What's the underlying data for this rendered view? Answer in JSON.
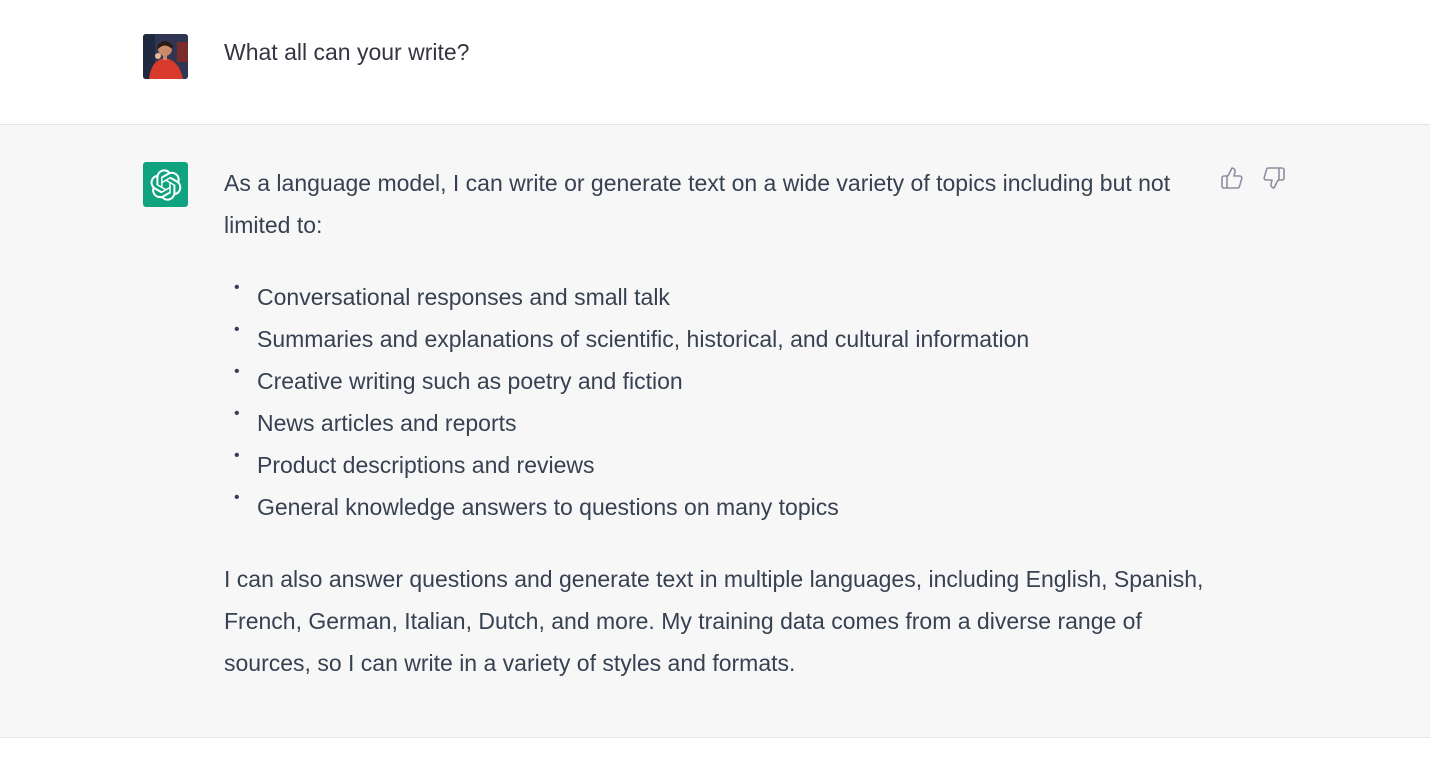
{
  "conversation": {
    "user_message": {
      "text": "What all can your write?",
      "avatar_icon": "user-photo-avatar"
    },
    "assistant_message": {
      "avatar_icon": "openai-logo-icon",
      "avatar_color": "#10a37f",
      "intro": "As a language model, I can write or generate text on a wide variety of topics including but not limited to:",
      "items": [
        "Conversational responses and small talk",
        "Summaries and explanations of scientific, historical, and cultural information",
        "Creative writing such as poetry and fiction",
        "News articles and reports",
        "Product descriptions and reviews",
        "General knowledge answers to questions on many topics"
      ],
      "closing": "I can also answer questions and generate text in multiple languages, including English, Spanish, French, German, Italian, Dutch, and more. My training data comes from a diverse range of sources, so I can write in a variety of styles and formats.",
      "feedback": {
        "like_icon": "thumbs-up-icon",
        "dislike_icon": "thumbs-down-icon"
      }
    }
  }
}
